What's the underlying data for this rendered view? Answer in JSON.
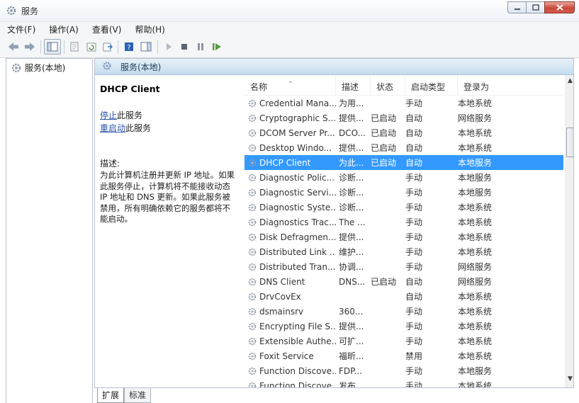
{
  "window": {
    "title": "服务",
    "min_icon": "minimize-icon",
    "max_icon": "maximize-icon",
    "close_icon": "close-icon"
  },
  "menu": [
    "文件(F)",
    "操作(A)",
    "查看(V)",
    "帮助(H)"
  ],
  "toolbar": [
    "back-arrow-icon",
    "forward-arrow-icon",
    "console-tree-icon",
    "properties-icon",
    "refresh-icon",
    "export-list-icon",
    "help-icon",
    "show-hide-action-pane-icon",
    "start-service-icon",
    "stop-service-icon",
    "pause-service-icon",
    "restart-service-icon"
  ],
  "tree": {
    "label": "服务(本地)"
  },
  "panel": {
    "header": "服务(本地)",
    "selected_title": "DHCP Client",
    "action_stop": "停止",
    "action_stop_suffix": "此服务",
    "action_restart": "重启动",
    "action_restart_suffix": "此服务",
    "desc_label": "描述:",
    "desc_lines": [
      "为此计算机注册并更新 IP 地址。如果",
      "此服务停止，计算机将不能接收动态",
      "IP 地址和 DNS 更新。如果此服务被",
      "禁用，所有明确依赖它的服务都将不",
      "能启动。"
    ]
  },
  "columns": {
    "name": "名称",
    "desc": "描述",
    "status": "状态",
    "startup": "启动类型",
    "logon": "登录为"
  },
  "services": [
    {
      "name": "Credential Mana...",
      "desc": "为用...",
      "status": "",
      "startup": "手动",
      "logon": "本地系统"
    },
    {
      "name": "Cryptographic S...",
      "desc": "提供...",
      "status": "已启动",
      "startup": "自动",
      "logon": "网络服务"
    },
    {
      "name": "DCOM Server Pr...",
      "desc": "DCO...",
      "status": "已启动",
      "startup": "自动",
      "logon": "本地系统"
    },
    {
      "name": "Desktop Windo...",
      "desc": "提供...",
      "status": "已启动",
      "startup": "自动",
      "logon": "本地系统"
    },
    {
      "name": "DHCP Client",
      "desc": "为此...",
      "status": "已启动",
      "startup": "自动",
      "logon": "本地服务",
      "selected": true
    },
    {
      "name": "Diagnostic Polic...",
      "desc": "诊断...",
      "status": "",
      "startup": "手动",
      "logon": "本地服务"
    },
    {
      "name": "Diagnostic Servi...",
      "desc": "诊断...",
      "status": "",
      "startup": "手动",
      "logon": "本地服务"
    },
    {
      "name": "Diagnostic Syste...",
      "desc": "诊断...",
      "status": "",
      "startup": "手动",
      "logon": "本地系统"
    },
    {
      "name": "Diagnostics Trac...",
      "desc": "The ...",
      "status": "",
      "startup": "手动",
      "logon": "本地系统"
    },
    {
      "name": "Disk Defragmen...",
      "desc": "提供...",
      "status": "",
      "startup": "手动",
      "logon": "本地系统"
    },
    {
      "name": "Distributed Link ...",
      "desc": "维护...",
      "status": "",
      "startup": "手动",
      "logon": "本地系统"
    },
    {
      "name": "Distributed Tran...",
      "desc": "协调...",
      "status": "",
      "startup": "手动",
      "logon": "网络服务"
    },
    {
      "name": "DNS Client",
      "desc": "DNS...",
      "status": "已启动",
      "startup": "自动",
      "logon": "网络服务"
    },
    {
      "name": "DrvCovEx",
      "desc": "",
      "status": "",
      "startup": "自动",
      "logon": "本地系统"
    },
    {
      "name": "dsmainsrv",
      "desc": "360...",
      "status": "",
      "startup": "手动",
      "logon": "本地系统"
    },
    {
      "name": "Encrypting File S...",
      "desc": "提供...",
      "status": "",
      "startup": "手动",
      "logon": "本地系统"
    },
    {
      "name": "Extensible Authe...",
      "desc": "可扩...",
      "status": "",
      "startup": "手动",
      "logon": "本地系统"
    },
    {
      "name": "Foxit Service",
      "desc": "福昕...",
      "status": "",
      "startup": "禁用",
      "logon": "本地系统"
    },
    {
      "name": "Function Discove...",
      "desc": "FDP...",
      "status": "",
      "startup": "手动",
      "logon": "本地服务"
    },
    {
      "name": "Function Discove...",
      "desc": "发布...",
      "status": "",
      "startup": "手动",
      "logon": "本地系统"
    }
  ],
  "tabs": [
    "扩展",
    "标准"
  ]
}
